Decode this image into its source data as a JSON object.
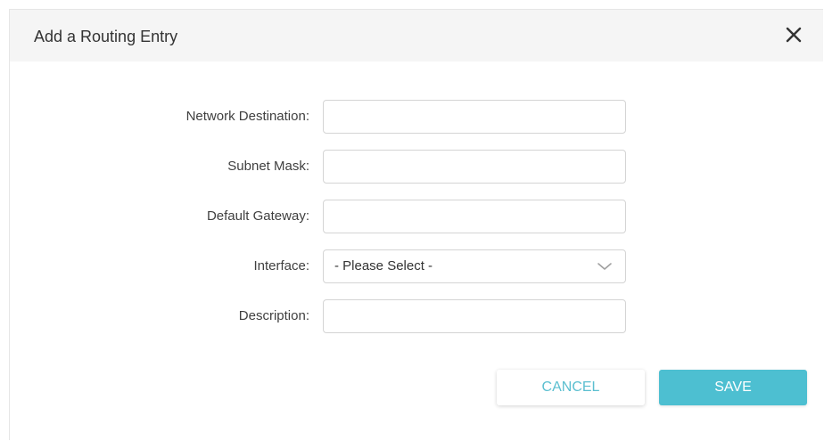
{
  "dialog": {
    "title": "Add a Routing Entry",
    "close_icon": "close-icon"
  },
  "form": {
    "network_destination": {
      "label": "Network Destination:",
      "value": "",
      "placeholder": ""
    },
    "subnet_mask": {
      "label": "Subnet Mask:",
      "value": "",
      "placeholder": ""
    },
    "default_gateway": {
      "label": "Default Gateway:",
      "value": "",
      "placeholder": ""
    },
    "interface": {
      "label": "Interface:",
      "selected": "- Please Select -",
      "icon": "chevron-down-icon"
    },
    "description": {
      "label": "Description:",
      "value": "",
      "placeholder": ""
    }
  },
  "actions": {
    "cancel_label": "CANCEL",
    "save_label": "SAVE"
  },
  "colors": {
    "accent": "#4dbfd1",
    "header_bg": "#f5f5f5",
    "border": "#d4d4d4"
  }
}
